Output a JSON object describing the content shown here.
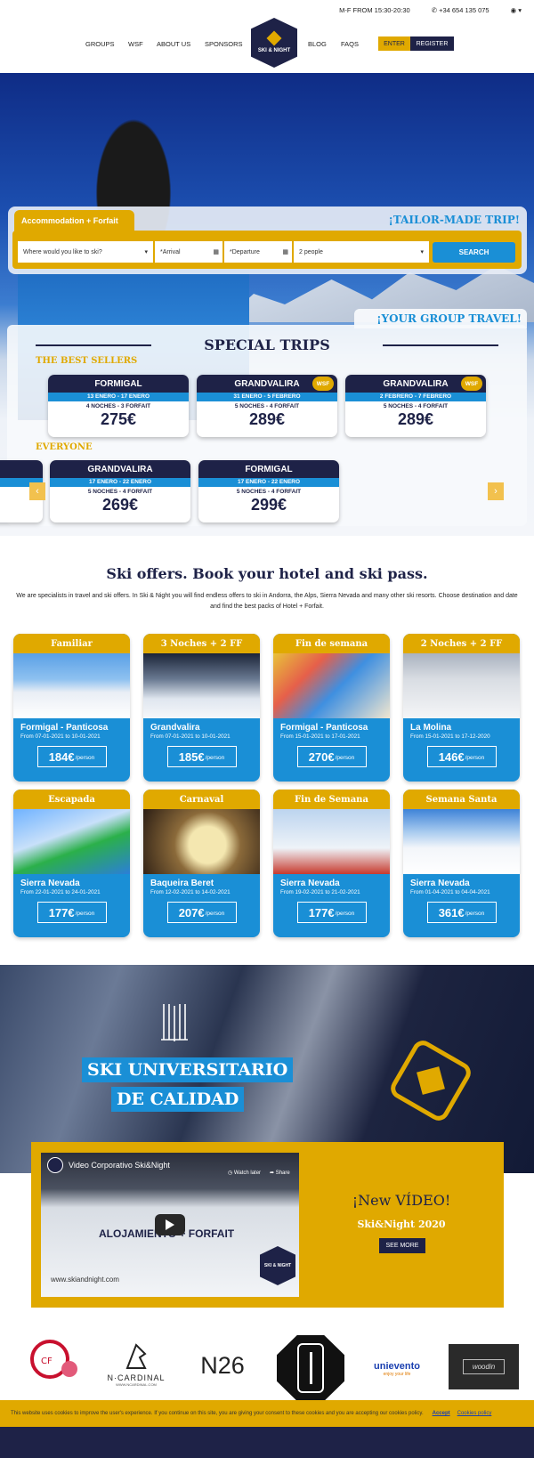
{
  "header": {
    "hours": "M-F FROM 15:30-20:30",
    "phone": "+34 654 135 075",
    "language_icon": "globe-icon",
    "nav": [
      "GROUPS",
      "WSF",
      "ABOUT US",
      "SPONSORS",
      "BLOG",
      "FAQS"
    ],
    "logo_text": "SKI & NIGHT",
    "enter": "ENTER",
    "register": "REGISTER"
  },
  "search": {
    "tab": "Accommodation + Forfait",
    "tailor": "¡TAILOR-MADE TRIP!",
    "destination": "Where would you like to ski?",
    "arrival": "*Arrival",
    "departure": "*Departure",
    "people": "2 people",
    "button": "SEARCH"
  },
  "special": {
    "group_travel": "¡YOUR GROUP TRAVEL!",
    "title": "SPECIAL TRIPS",
    "best_sellers": "THE BEST SELLERS",
    "everyone": "EVERYONE",
    "best": [
      {
        "name": "FORMIGAL",
        "dates": "13 ENERO - 17 ENERO",
        "desc": "4 NOCHES - 3 FORFAIT",
        "price": "275€",
        "wsf": ""
      },
      {
        "name": "GRANDVALIRA",
        "dates": "31 ENERO - 5 FEBRERO",
        "desc": "5 NOCHES - 4 FORFAIT",
        "price": "289€",
        "wsf": "WSF"
      },
      {
        "name": "GRANDVALIRA",
        "dates": "2 FEBRERO - 7 FEBRERO",
        "desc": "5 NOCHES - 4 FORFAIT",
        "price": "289€",
        "wsf": "WSF"
      }
    ],
    "all": [
      {
        "name": "GRANDVALIRA",
        "dates": "17 ENERO - 22 ENERO",
        "desc": "5 NOCHES - 4 FORFAIT",
        "price": "269€"
      },
      {
        "name": "FORMIGAL",
        "dates": "17 ENERO - 22 ENERO",
        "desc": "5 NOCHES - 4 FORFAIT",
        "price": "299€"
      }
    ]
  },
  "offers": {
    "title": "Ski offers. Book your hotel and ski pass.",
    "desc": "We are specialists in travel and ski offers. In Ski & Night you will find endless offers to ski in Andorra, the Alps, Sierra Nevada and many other ski resorts. Choose destination and date and find the best packs of Hotel + Forfait.",
    "per": "/person",
    "cards": [
      {
        "tag": "Familiar",
        "name": "Formigal - Panticosa",
        "dates": "From 07-01-2021 to 10-01-2021",
        "price": "184€"
      },
      {
        "tag": "3 Noches + 2 FF",
        "name": "Grandvalira",
        "dates": "From 07-01-2021 to 10-01-2021",
        "price": "185€"
      },
      {
        "tag": "Fin de semana",
        "name": "Formigal - Panticosa",
        "dates": "From 15-01-2021 to 17-01-2021",
        "price": "270€"
      },
      {
        "tag": "2 Noches + 2 FF",
        "name": "La Molina",
        "dates": "From 15-01-2021 to 17-12-2020",
        "price": "146€"
      },
      {
        "tag": "Escapada",
        "name": "Sierra Nevada",
        "dates": "From 22-01-2021 to 24-01-2021",
        "price": "177€"
      },
      {
        "tag": "Carnaval",
        "name": "Baqueira Beret",
        "dates": "From 12-02-2021 to 14-02-2021",
        "price": "207€"
      },
      {
        "tag": "Fin de Semana",
        "name": "Sierra Nevada",
        "dates": "From 19-02-2021 to 21-02-2021",
        "price": "177€"
      },
      {
        "tag": "Semana Santa",
        "name": "Sierra Nevada",
        "dates": "From 01-04-2021 to 04-04-2021",
        "price": "361€"
      }
    ]
  },
  "university": {
    "line1": "SKI UNIVERSITARIO",
    "line2": "DE CALIDAD"
  },
  "video": {
    "title": "Video Corporativo Ski&Night",
    "watch_later": "Watch later",
    "share": "Share",
    "overlay": "ALOJAMIENTO + FORFAIT",
    "url": "www.skiandnight.com",
    "badge": "SKI & NIGHT",
    "new": "¡New VÍDEO!",
    "sub": "Ski&Night 2020",
    "see_more": "SEE MORE"
  },
  "sponsors": {
    "ncardinal": "N·CARDINAL",
    "ncardinal_sub": "WWW.NCARDINAL.COM",
    "n26": "N26",
    "univento": "unievento",
    "univento_sub": "enjoy your life",
    "woodin": "woodin"
  },
  "cookie": {
    "text": "This website uses cookies to improve the user's experience. If you continue on this site, you are giving your consent to these cookies and you are accepting our cookies policy.",
    "accept": "Accept",
    "policy": "Cookies policy"
  },
  "colors": {
    "navy": "#1e2247",
    "gold": "#e0a900",
    "blue": "#1a8fd6"
  }
}
